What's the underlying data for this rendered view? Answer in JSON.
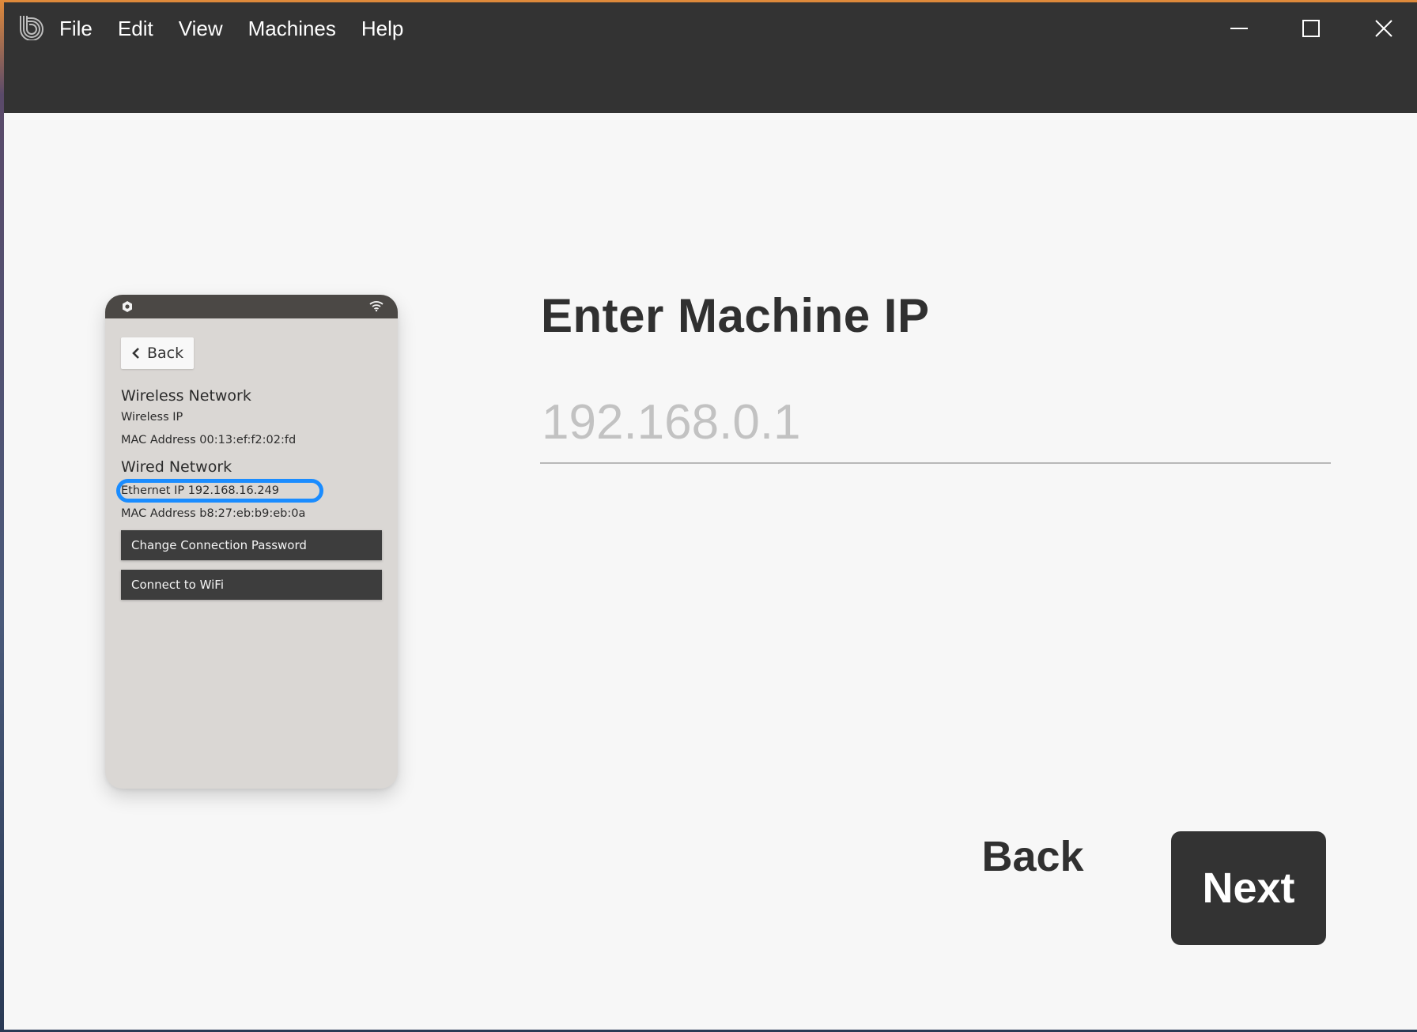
{
  "menu": {
    "items": [
      {
        "label": "File"
      },
      {
        "label": "Edit"
      },
      {
        "label": "View"
      },
      {
        "label": "Machines"
      },
      {
        "label": "Help"
      }
    ]
  },
  "icons": {
    "logo": "app-logo-icon",
    "minimize": "minimize-icon",
    "maximize": "maximize-icon",
    "close": "close-icon"
  },
  "illustration": {
    "back_label": "Back",
    "wireless_heading": "Wireless Network",
    "wireless_ip_label": "Wireless IP",
    "wireless_mac": "MAC Address 00:13:ef:f2:02:fd",
    "wired_heading": "Wired Network",
    "ethernet_ip": "Ethernet IP  192.168.16.249",
    "wired_mac": "MAC Address b8:27:eb:b9:eb:0a",
    "btn_change_password": "Change Connection Password",
    "btn_connect_wifi": "Connect to WiFi",
    "highlight_color": "#1a8cff"
  },
  "main": {
    "title": "Enter Machine IP",
    "ip_field": {
      "value": "",
      "placeholder": "192.168.0.1"
    },
    "back_label": "Back",
    "next_label": "Next"
  }
}
